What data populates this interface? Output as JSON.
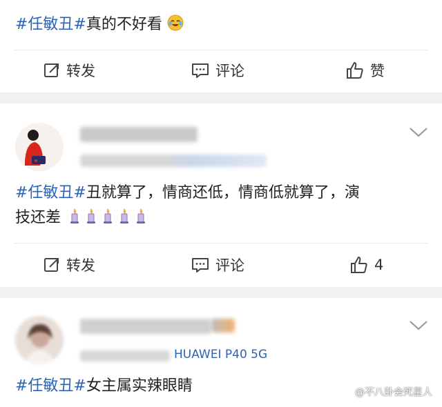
{
  "posts": [
    {
      "hashtag": "#任敏丑#",
      "text": "真的不好看",
      "emoji": "laughing-crying-emoji",
      "actions": {
        "repost": "转发",
        "comment": "评论",
        "like": "赞"
      }
    },
    {
      "hashtag": "#任敏丑#",
      "text_line1": "丑就算了，情商还低，情商低就算了，演",
      "text_line2": "技还差",
      "emoji": "candle-emoji",
      "emoji_count": 5,
      "actions": {
        "repost": "转发",
        "comment": "评论",
        "like_count": "4"
      }
    },
    {
      "device": "HUAWEI P40 5G",
      "hashtag": "#任敏丑#",
      "text": "女主属实辣眼睛"
    }
  ],
  "watermark": "@不八卦会死星人",
  "colors": {
    "link": "#2b63b6",
    "separator": "#f1f1f1",
    "text": "#1f1f1f"
  }
}
